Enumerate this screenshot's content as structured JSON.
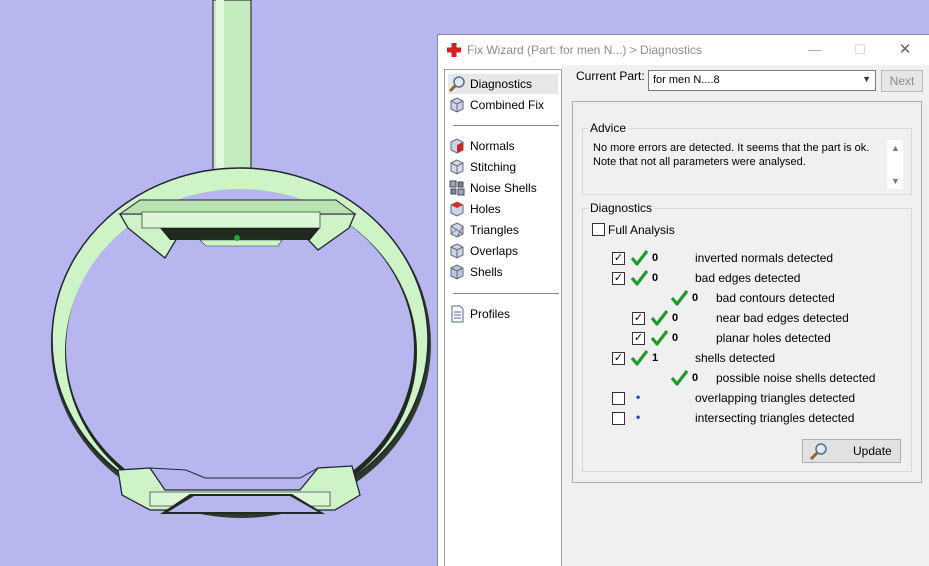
{
  "window": {
    "title": "Fix Wizard (Part: for men N...) > Diagnostics",
    "minimize": "—",
    "maximize": "☐",
    "close": "✕"
  },
  "nav": {
    "items": [
      {
        "label": "Diagnostics",
        "icon": "magnifier-icon"
      },
      {
        "label": "Combined Fix",
        "icon": "cube-icon"
      },
      {
        "label": "Normals",
        "icon": "normals-cube-icon"
      },
      {
        "label": "Stitching",
        "icon": "stitching-cube-icon"
      },
      {
        "label": "Noise Shells",
        "icon": "noise-shells-icon"
      },
      {
        "label": "Holes",
        "icon": "holes-cube-icon"
      },
      {
        "label": "Triangles",
        "icon": "triangles-cube-icon"
      },
      {
        "label": "Overlaps",
        "icon": "overlaps-cube-icon"
      },
      {
        "label": "Shells",
        "icon": "shells-cube-icon"
      },
      {
        "label": "Profiles",
        "icon": "document-icon"
      }
    ]
  },
  "part": {
    "label": "Current Part:",
    "value": "for men N....8",
    "next": "Next"
  },
  "advice": {
    "title": "Advice",
    "line1": "No more errors are detected. It seems that the part is ok.",
    "line2": "Note that not all parameters were analysed."
  },
  "diagnostics": {
    "title": "Diagnostics",
    "full_analysis": "Full Analysis",
    "full_analysis_checked": false,
    "rows": [
      {
        "label": "inverted normals detected",
        "count": "0",
        "checked": true,
        "has_checkbox": true,
        "ok": true
      },
      {
        "label": "bad edges detected",
        "count": "0",
        "checked": true,
        "has_checkbox": true,
        "ok": true
      },
      {
        "label": "bad contours detected",
        "count": "0",
        "checked": false,
        "has_checkbox": false,
        "ok": true
      },
      {
        "label": "near bad edges detected",
        "count": "0",
        "checked": true,
        "has_checkbox": true,
        "ok": true
      },
      {
        "label": "planar holes detected",
        "count": "0",
        "checked": true,
        "has_checkbox": true,
        "ok": true
      },
      {
        "label": "shells detected",
        "count": "1",
        "checked": true,
        "has_checkbox": true,
        "ok": true
      },
      {
        "label": "possible noise shells detected",
        "count": "0",
        "checked": false,
        "has_checkbox": false,
        "ok": true
      },
      {
        "label": "overlapping triangles detected",
        "count": "•",
        "checked": false,
        "has_checkbox": true,
        "ok": false
      },
      {
        "label": "intersecting triangles detected",
        "count": "•",
        "checked": false,
        "has_checkbox": true,
        "ok": false
      }
    ],
    "update": "Update"
  },
  "colors": {
    "viewport_bg": "#b7b7f0",
    "model_fill": "#cdf3c7",
    "check_green": "#1f9a2a"
  }
}
